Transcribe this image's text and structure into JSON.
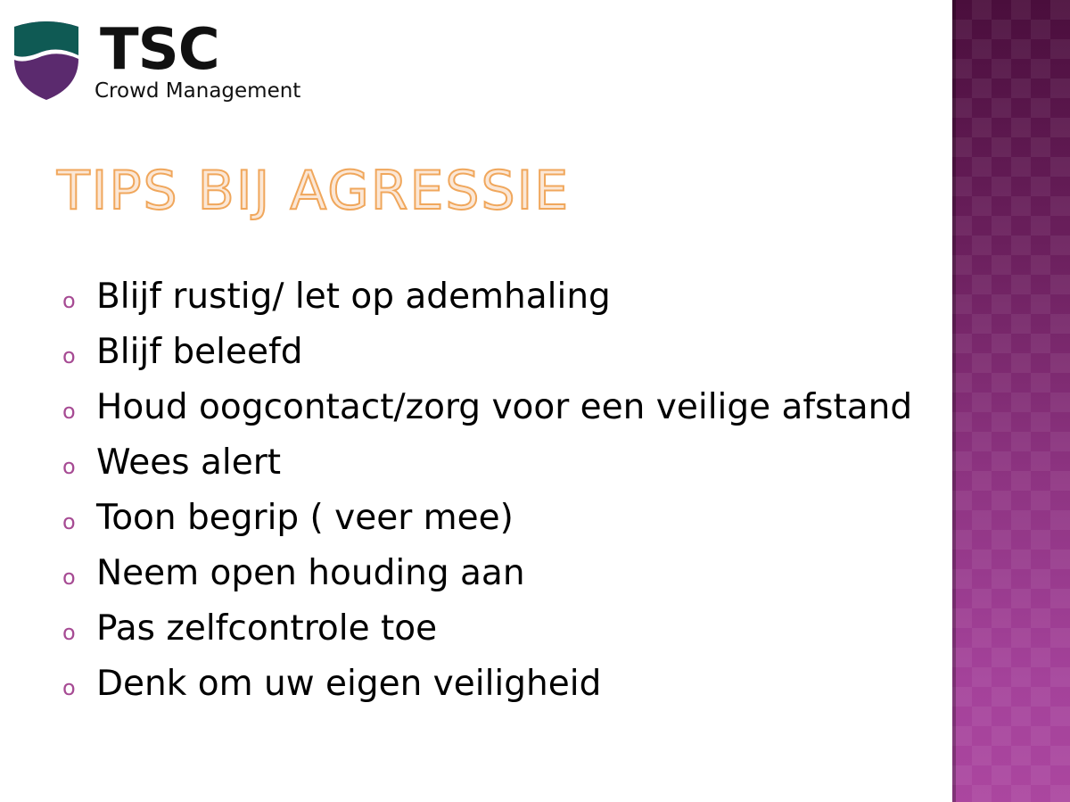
{
  "logo": {
    "brand": "TSC",
    "tagline": "Crowd Management"
  },
  "slide": {
    "title": "TIPS BIJ AGRESSIE",
    "bullet_marker": "o",
    "bullets": [
      "Blijf rustig/ let op ademhaling",
      "Blijf beleefd",
      "Houd oogcontact/zorg voor een veilige afstand",
      "Wees alert",
      "Toon begrip ( veer mee)",
      "Neem open houding aan",
      "Pas zelfcontrole toe",
      "Denk om uw eigen veiligheid"
    ]
  },
  "colors": {
    "title_fill": "#fbe7d6",
    "title_outline": "#f0a75c",
    "bullet_marker": "#a64a93",
    "side_band": "#8e3482",
    "shield_green": "#0f5a54",
    "shield_purple": "#5b2a6e"
  }
}
